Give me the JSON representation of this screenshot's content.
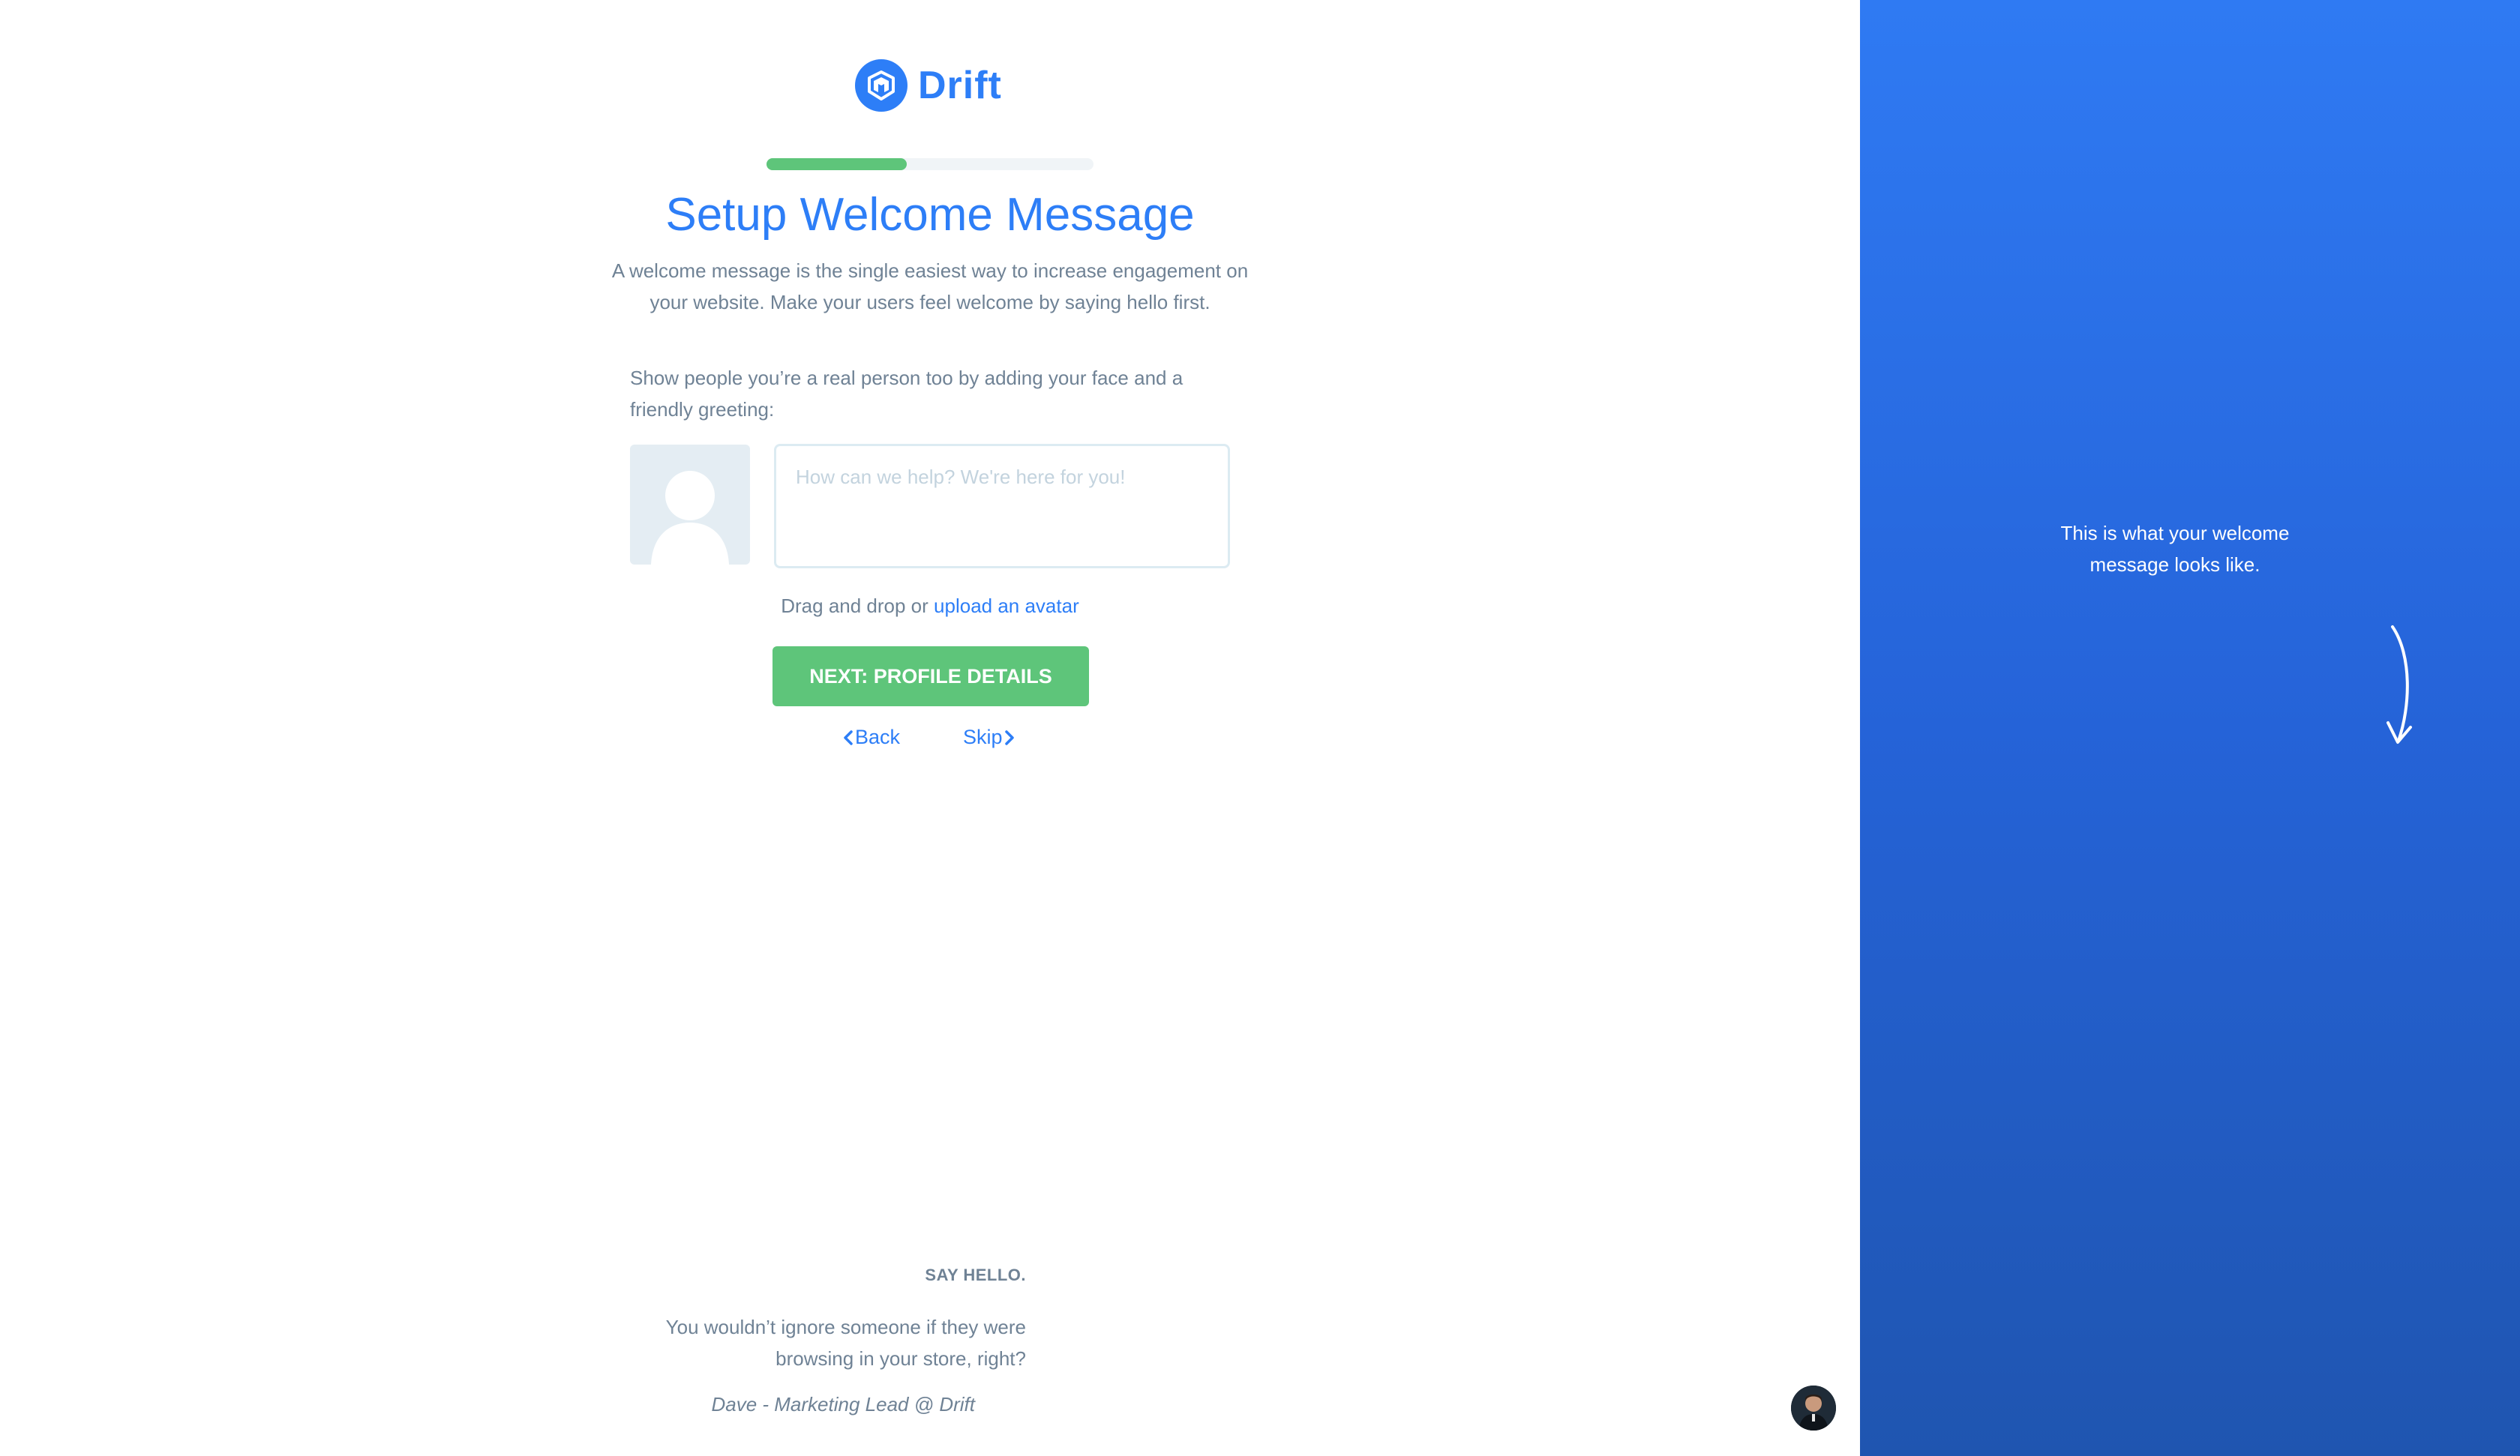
{
  "brand": {
    "name": "Drift",
    "accent_color": "#2d7ef7",
    "success_color": "#5ec57a"
  },
  "progress": {
    "fraction": 0.43
  },
  "header": {
    "title": "Setup Welcome Message",
    "subtitle": "A welcome message is the single easiest way to increase engagement on your website. Make your users feel welcome by saying hello first."
  },
  "form": {
    "instruction": "Show people you’re a real person too by adding your face and a friendly greeting:",
    "greeting_placeholder": "How can we help? We're here for you!",
    "greeting_value": "",
    "drag_text": "Drag and drop or",
    "upload_link": "upload an avatar",
    "next_button": "NEXT: PROFILE DETAILS",
    "back_label": "Back",
    "skip_label": "Skip"
  },
  "testimonial": {
    "label": "SAY HELLO.",
    "quote": "You wouldn’t ignore someone if they were browsing in your store, right?",
    "author": "Dave - Marketing Lead @ Drift"
  },
  "preview_panel": {
    "note": "This is what your welcome message looks like."
  }
}
